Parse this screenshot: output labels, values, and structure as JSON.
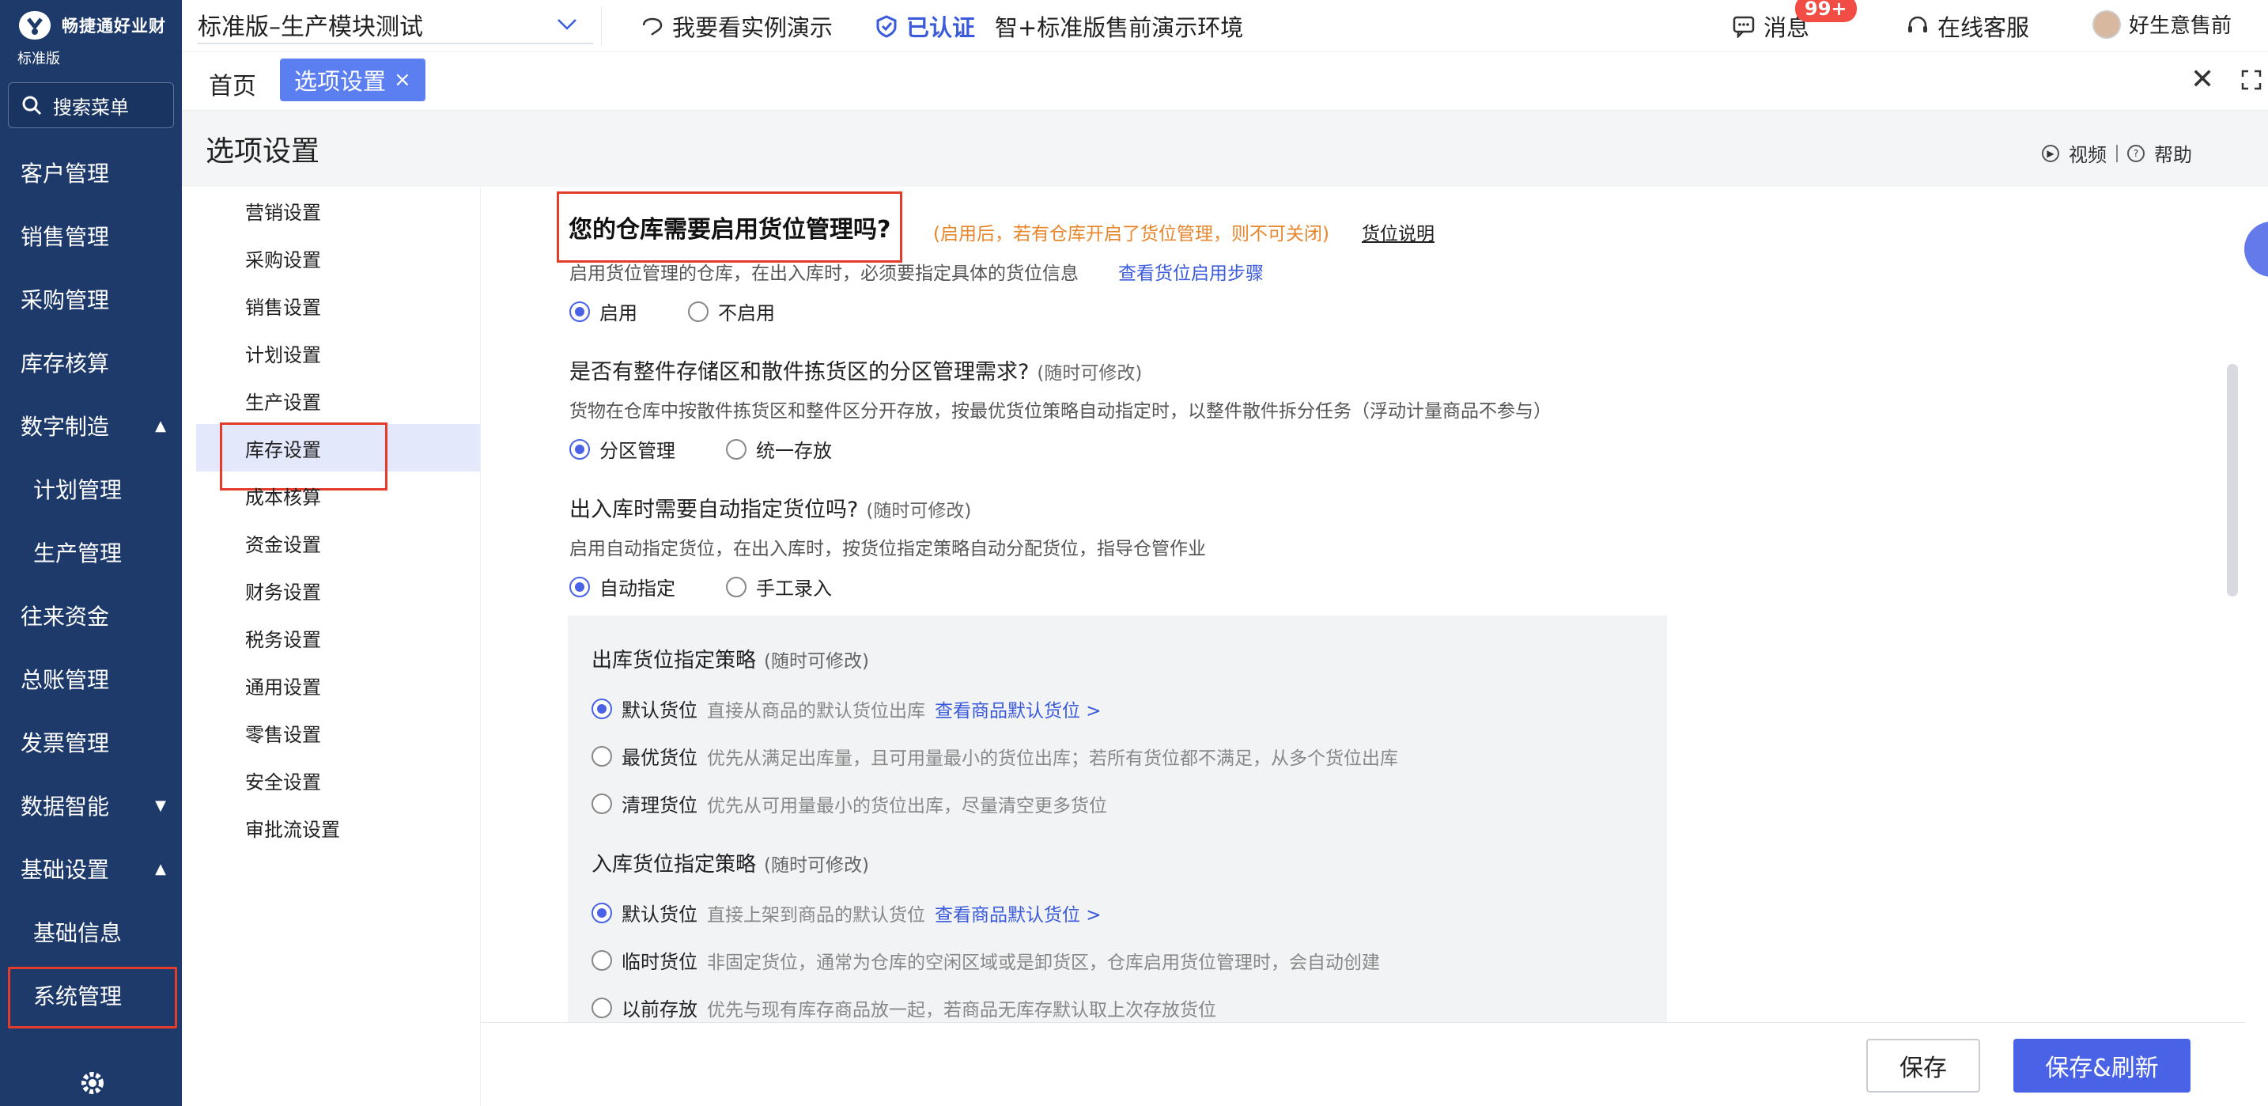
{
  "sidebar": {
    "brand": "畅捷通好业财",
    "version": "标准版",
    "search_placeholder": "搜索菜单",
    "items": [
      {
        "label": "客户管理",
        "caret": ""
      },
      {
        "label": "销售管理",
        "caret": ""
      },
      {
        "label": "采购管理",
        "caret": ""
      },
      {
        "label": "库存核算",
        "caret": ""
      },
      {
        "label": "数字制造",
        "caret": "▲"
      },
      {
        "label": "计划管理",
        "caret": ""
      },
      {
        "label": "生产管理",
        "caret": ""
      },
      {
        "label": "往来资金",
        "caret": ""
      },
      {
        "label": "总账管理",
        "caret": ""
      },
      {
        "label": "发票管理",
        "caret": ""
      },
      {
        "label": "数据智能",
        "caret": "▼"
      },
      {
        "label": "基础设置",
        "caret": "▲"
      },
      {
        "label": "基础信息",
        "caret": ""
      },
      {
        "label": "系统管理",
        "caret": ""
      }
    ]
  },
  "topbar": {
    "org": "标准版–生产模块测试",
    "demo": "我要看实例演示",
    "certified": "已认证",
    "env": "智+标准版售前演示环境",
    "messages": "消息",
    "msg_count": "99+",
    "service": "在线客服",
    "user": "好生意售前"
  },
  "tabs": {
    "home": "首页",
    "active": "选项设置",
    "close": "×"
  },
  "page": {
    "title": "选项设置",
    "video": "视频",
    "help": "帮助"
  },
  "setnav": [
    "营销设置",
    "采购设置",
    "销售设置",
    "计划设置",
    "生产设置",
    "库存设置",
    "成本核算",
    "资金设置",
    "财务设置",
    "税务设置",
    "通用设置",
    "零售设置",
    "安全设置",
    "审批流设置"
  ],
  "content": {
    "q1": {
      "title": "您的仓库需要启用货位管理吗?",
      "note": "(启用后，若有仓库开启了货位管理，则不可关闭)",
      "link": "货位说明",
      "desc": "启用货位管理的仓库，在出入库时，必须要指定具体的货位信息",
      "desc_link": "查看货位启用步骤",
      "opt_on": "启用",
      "opt_off": "不启用"
    },
    "q2": {
      "title": "是否有整件存储区和散件拣货区的分区管理需求?",
      "sub": "(随时可修改)",
      "desc": "货物在仓库中按散件拣货区和整件区分开存放，按最优货位策略自动指定时，以整件散件拆分任务（浮动计量商品不参与）",
      "opt_a": "分区管理",
      "opt_b": "统一存放"
    },
    "q3": {
      "title": "出入库时需要自动指定货位吗?",
      "sub": "(随时可修改)",
      "desc": "启用自动指定货位，在出入库时，按货位指定策略自动分配货位，指导仓管作业",
      "opt_a": "自动指定",
      "opt_b": "手工录入"
    },
    "out_policy": {
      "title": "出库货位指定策略",
      "sub": "(随时可修改)",
      "options": [
        {
          "label": "默认货位",
          "desc": "直接从商品的默认货位出库",
          "link": "查看商品默认货位 >"
        },
        {
          "label": "最优货位",
          "desc": "优先从满足出库量，且可用量最小的货位出库；若所有货位都不满足，从多个货位出库",
          "link": ""
        },
        {
          "label": "清理货位",
          "desc": "优先从可用量最小的货位出库，尽量清空更多货位",
          "link": ""
        }
      ]
    },
    "in_policy": {
      "title": "入库货位指定策略",
      "sub": "(随时可修改)",
      "options": [
        {
          "label": "默认货位",
          "desc": "直接上架到商品的默认货位",
          "link": "查看商品默认货位 >"
        },
        {
          "label": "临时货位",
          "desc": "非固定货位，通常为仓库的空闲区域或是卸货区，仓库启用货位管理时，会自动创建",
          "link": ""
        },
        {
          "label": "以前存放",
          "desc": "优先与现有库存商品放一起，若商品无库存默认取上次存放货位",
          "link": ""
        }
      ]
    }
  },
  "footer": {
    "save": "保存",
    "save_refresh": "保存&刷新"
  },
  "colors": {
    "sidebar_bg": "#1d3a6b",
    "accent": "#4a63e6",
    "highlight_border": "#e23c2b",
    "warning_text": "#e8862c"
  }
}
